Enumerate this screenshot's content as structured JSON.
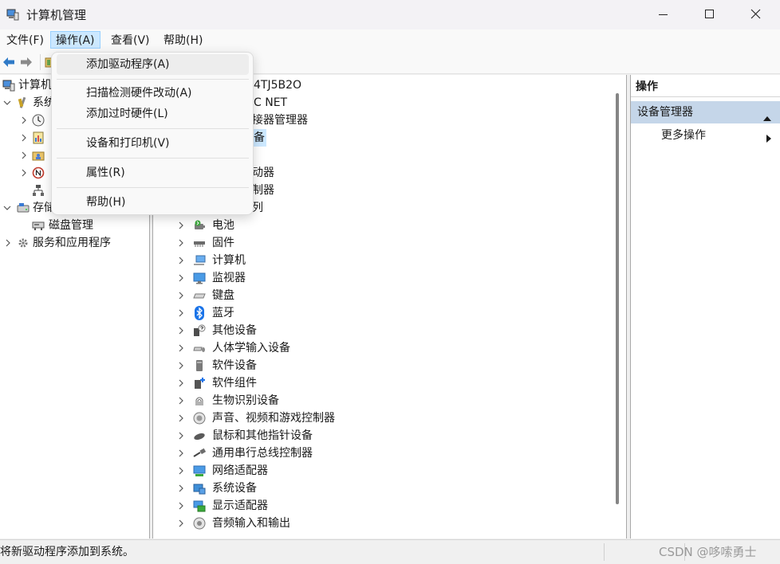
{
  "window": {
    "title": "计算机管理",
    "icon": "computer-management-icon",
    "controls": [
      "minimize-icon",
      "maximize-icon",
      "close-icon"
    ]
  },
  "menubar": {
    "items": [
      {
        "label": "文件(F)"
      },
      {
        "label": "操作(A)",
        "active": true
      },
      {
        "label": "查看(V)"
      },
      {
        "label": "帮助(H)"
      }
    ]
  },
  "toolbar": {
    "buttons": [
      "back-arrow-icon",
      "forward-arrow-icon",
      "console-tree-icon"
    ]
  },
  "tree": {
    "items": [
      {
        "label": "计算机",
        "icon": "computer-management-icon",
        "expanded": true
      },
      {
        "label": "系统",
        "icon": "system-tools-icon",
        "expanded": true
      },
      {
        "icon": "task-scheduler-icon",
        "expanded": false
      },
      {
        "icon": "event-viewer-icon",
        "expanded": false
      },
      {
        "icon": "shared-folders-icon",
        "expanded": false
      },
      {
        "icon": "performance-icon",
        "expanded": false
      },
      {
        "icon": "device-manager-icon",
        "selected": true
      },
      {
        "label": "存储",
        "icon": "storage-icon",
        "expanded": true
      },
      {
        "label": "磁盘管理",
        "icon": "disk-management-icon"
      },
      {
        "label": "服务和应用程序",
        "icon": "services-icon",
        "expanded": false
      }
    ]
  },
  "devices": {
    "partial_items": [
      "4TJ5B2O",
      "C NET",
      "接器管理器",
      "备",
      "动器",
      "制器",
      "列"
    ],
    "selected_partial": "备",
    "items": [
      {
        "label": "电池",
        "icon": "battery-icon"
      },
      {
        "label": "固件",
        "icon": "firmware-icon"
      },
      {
        "label": "计算机",
        "icon": "computer-icon"
      },
      {
        "label": "监视器",
        "icon": "monitor-icon"
      },
      {
        "label": "键盘",
        "icon": "keyboard-icon"
      },
      {
        "label": "蓝牙",
        "icon": "bluetooth-icon"
      },
      {
        "label": "其他设备",
        "icon": "other-devices-icon"
      },
      {
        "label": "人体学输入设备",
        "icon": "hid-icon"
      },
      {
        "label": "软件设备",
        "icon": "software-device-icon"
      },
      {
        "label": "软件组件",
        "icon": "software-component-icon"
      },
      {
        "label": "生物识别设备",
        "icon": "biometric-icon"
      },
      {
        "label": "声音、视频和游戏控制器",
        "icon": "sound-icon"
      },
      {
        "label": "鼠标和其他指针设备",
        "icon": "mouse-icon"
      },
      {
        "label": "通用串行总线控制器",
        "icon": "usb-icon"
      },
      {
        "label": "网络适配器",
        "icon": "network-adapter-icon"
      },
      {
        "label": "系统设备",
        "icon": "system-device-icon"
      },
      {
        "label": "显示适配器",
        "icon": "display-adapter-icon"
      },
      {
        "label": "音频输入和输出",
        "icon": "audio-io-icon"
      }
    ]
  },
  "actions_pane": {
    "header": "操作",
    "section": "设备管理器",
    "more": "更多操作"
  },
  "context_menu": {
    "items": [
      {
        "label": "添加驱动程序(A)",
        "highlighted": true
      },
      {
        "label": "扫描检测硬件改动(A)"
      },
      {
        "label": "添加过时硬件(L)"
      },
      {
        "label": "设备和打印机(V)"
      },
      {
        "label": "属性(R)"
      },
      {
        "label": "帮助(H)"
      }
    ]
  },
  "status_bar": {
    "text": "将新驱动程序添加到系统。",
    "watermark": "CSDN @哆嗦勇士"
  },
  "colors": {
    "menu_active_bg": "#cce8ff",
    "section_bg": "#c5d6e9",
    "selection_bg": "#cce8ff",
    "bluetooth": "#1a73e8"
  }
}
